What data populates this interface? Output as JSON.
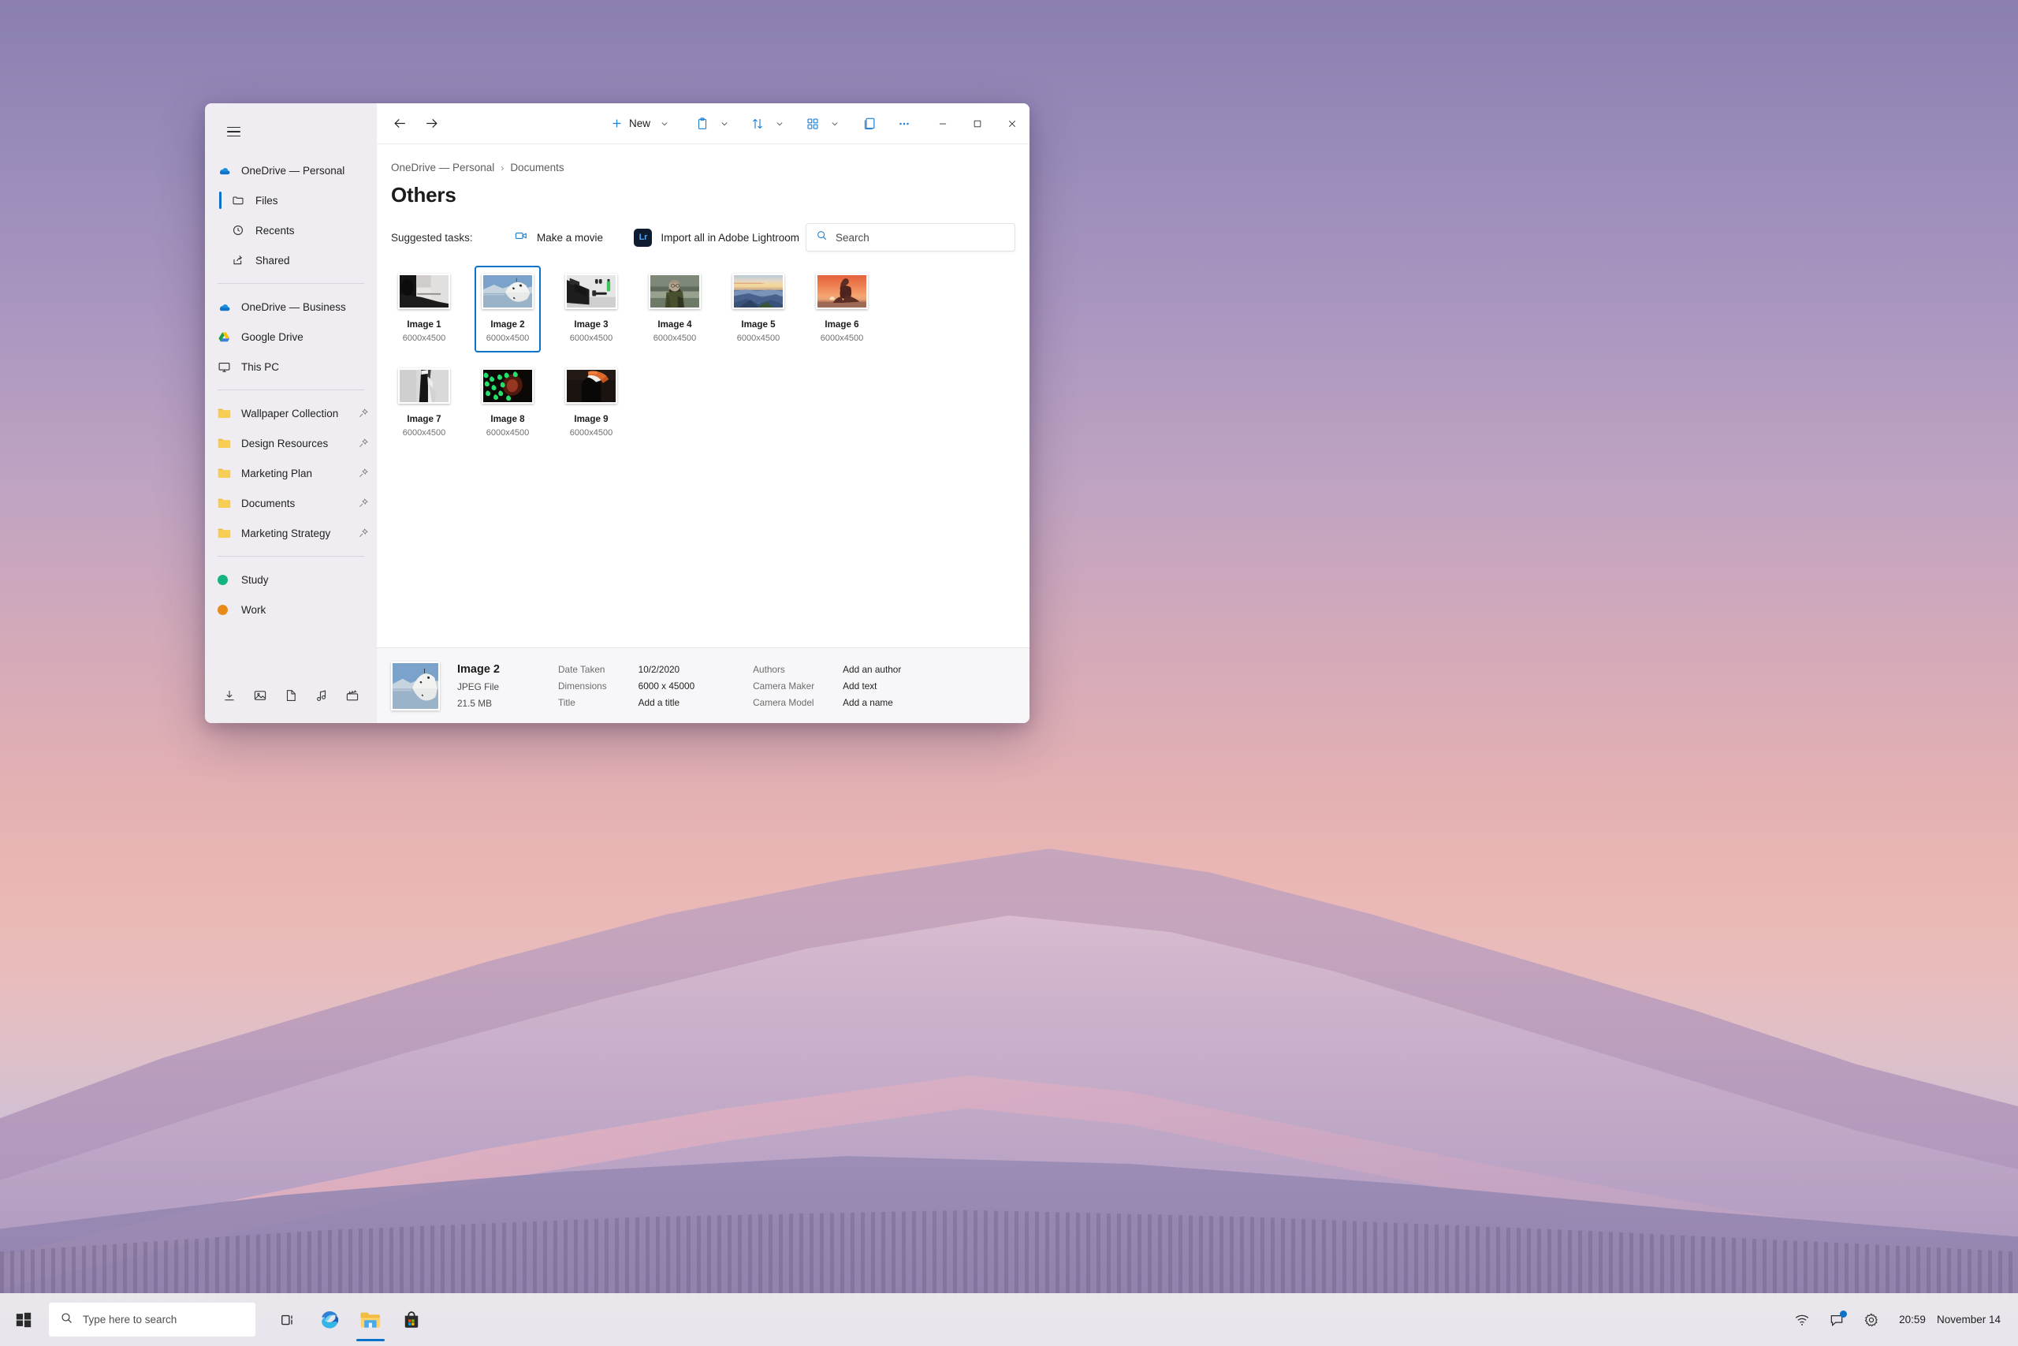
{
  "desktop": {
    "wallpaper_name": "snow-mountain-sunset-wallpaper"
  },
  "window": {
    "title": "File Explorer",
    "sidebar": {
      "menu_icon": "hamburger-icon",
      "sections": [
        {
          "header": {
            "label": "OneDrive — Personal",
            "icon": "onedrive-cloud-icon"
          },
          "children": [
            {
              "label": "Files",
              "icon": "folder-outline-icon",
              "selected": true
            },
            {
              "label": "Recents",
              "icon": "clock-icon",
              "selected": false
            },
            {
              "label": "Shared",
              "icon": "share-icon",
              "selected": false
            }
          ]
        }
      ],
      "accounts": [
        {
          "label": "OneDrive — Business",
          "icon": "onedrive-cloud-icon"
        },
        {
          "label": "Google Drive",
          "icon": "google-drive-icon"
        },
        {
          "label": "This PC",
          "icon": "monitor-icon"
        }
      ],
      "pinned_folders": [
        {
          "label": "Wallpaper Collection",
          "icon": "folder-icon",
          "pin": "pin-icon"
        },
        {
          "label": "Design Resources",
          "icon": "folder-icon",
          "pin": "pin-icon"
        },
        {
          "label": "Marketing Plan",
          "icon": "folder-icon",
          "pin": "pin-icon"
        },
        {
          "label": "Documents",
          "icon": "folder-icon",
          "pin": "pin-icon"
        },
        {
          "label": "Marketing Strategy",
          "icon": "folder-icon",
          "pin": "pin-icon"
        }
      ],
      "tags": [
        {
          "label": "Study",
          "color": "#16b37e"
        },
        {
          "label": "Work",
          "color": "#e88a1a"
        }
      ],
      "footer_icons": [
        "download-icon",
        "pictures-icon",
        "documents-icon",
        "music-icon",
        "videos-icon"
      ]
    },
    "toolbar": {
      "back_icon": "arrow-left-icon",
      "forward_icon": "arrow-right-icon",
      "new_label": "New",
      "new_icon": "plus-icon",
      "new_chevron": "chevron-down-icon",
      "paste_icon": "clipboard-paste-icon",
      "sort_icon": "sort-icon",
      "layout_icon": "layout-grid-icon",
      "details_pane_icon": "details-pane-icon",
      "more_icon": "more-ellipsis-icon",
      "minimize_icon": "minimize-icon",
      "maximize_icon": "maximize-icon",
      "close_icon": "close-icon"
    },
    "breadcrumb": {
      "root": "OneDrive — Personal",
      "separator": "›",
      "current": "Documents"
    },
    "page_title": "Others",
    "suggested": {
      "label": "Suggested tasks:",
      "tasks": [
        {
          "label": "Make a movie",
          "icon": "video-camera-icon"
        },
        {
          "label": "Import all in Adobe Lightroom",
          "icon": "lightroom-icon",
          "badge_text": "Lr"
        }
      ]
    },
    "search": {
      "placeholder": "Search",
      "value": "",
      "icon": "search-icon"
    },
    "files": [
      {
        "name": "Image 1",
        "meta": "6000x4500",
        "selected": false,
        "thumb": "bw-street-crowd"
      },
      {
        "name": "Image 2",
        "meta": "6000x4500",
        "selected": true,
        "thumb": "snow-mountain-lake"
      },
      {
        "name": "Image 3",
        "meta": "6000x4500",
        "selected": false,
        "thumb": "gym-dumbbells"
      },
      {
        "name": "Image 4",
        "meta": "6000x4500",
        "selected": false,
        "thumb": "bearded-person-camo"
      },
      {
        "name": "Image 5",
        "meta": "6000x4500",
        "selected": false,
        "thumb": "blue-mountain-sunset"
      },
      {
        "name": "Image 6",
        "meta": "6000x4500",
        "selected": false,
        "thumb": "orange-sunset-silhouette"
      },
      {
        "name": "Image 7",
        "meta": "6000x4500",
        "selected": false,
        "thumb": "bw-tower-abstract"
      },
      {
        "name": "Image 8",
        "meta": "6000x4500",
        "selected": false,
        "thumb": "green-neon-lights"
      },
      {
        "name": "Image 9",
        "meta": "6000x4500",
        "selected": false,
        "thumb": "orange-sneaker-dark"
      }
    ],
    "details": {
      "name": "Image 2",
      "file_type": "JPEG File",
      "file_size": "21.5 MB",
      "fields_left": [
        {
          "key": "Date Taken",
          "value": "10/2/2020"
        },
        {
          "key": "Dimensions",
          "value": "6000 x 45000"
        },
        {
          "key": "Title",
          "value": "Add a title"
        }
      ],
      "fields_right": [
        {
          "key": "Authors",
          "value": "Add an author"
        },
        {
          "key": "Camera Maker",
          "value": "Add text"
        },
        {
          "key": "Camera Model",
          "value": "Add a name"
        }
      ]
    }
  },
  "taskbar": {
    "start_icon": "windows-start-icon",
    "search": {
      "placeholder": "Type here to search",
      "value": "",
      "icon": "search-icon"
    },
    "apps": [
      {
        "name": "task-view",
        "icon": "task-view-icon",
        "active": false
      },
      {
        "name": "microsoft-edge",
        "icon": "edge-icon",
        "active": false
      },
      {
        "name": "file-explorer",
        "icon": "file-explorer-icon",
        "active": true
      },
      {
        "name": "microsoft-store",
        "icon": "store-icon",
        "active": false
      }
    ],
    "tray": {
      "wifi_icon": "wifi-icon",
      "chat_icon": "chat-icon",
      "settings_icon": "gear-icon",
      "time": "20:59",
      "date": "November 14"
    }
  }
}
